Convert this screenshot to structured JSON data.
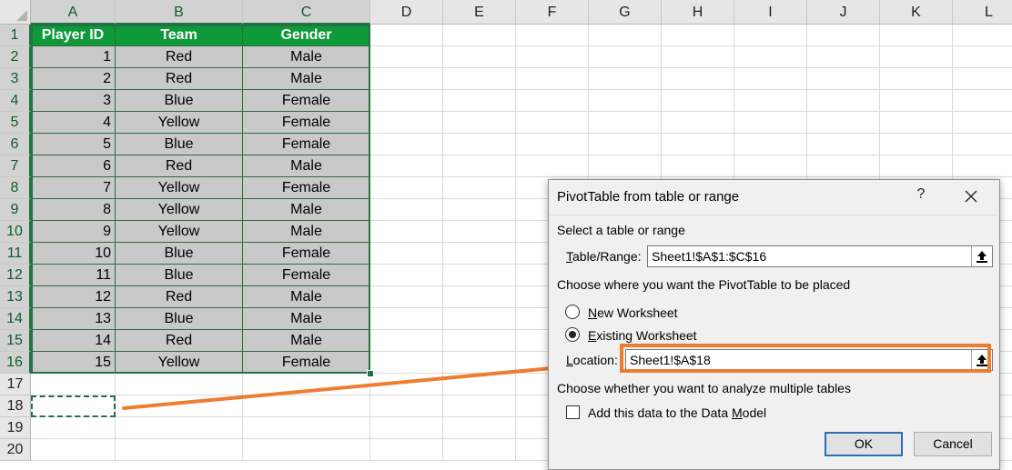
{
  "spreadsheet": {
    "columns": [
      "A",
      "B",
      "C",
      "D",
      "E",
      "F",
      "G",
      "H",
      "I",
      "J",
      "K",
      "L"
    ],
    "rows": [
      "1",
      "2",
      "3",
      "4",
      "5",
      "6",
      "7",
      "8",
      "9",
      "10",
      "11",
      "12",
      "13",
      "14",
      "15",
      "16",
      "17",
      "18",
      "19",
      "20"
    ],
    "headers": [
      "Player ID",
      "Team",
      "Gender"
    ],
    "data": [
      [
        "1",
        "Red",
        "Male"
      ],
      [
        "2",
        "Red",
        "Male"
      ],
      [
        "3",
        "Blue",
        "Female"
      ],
      [
        "4",
        "Yellow",
        "Female"
      ],
      [
        "5",
        "Blue",
        "Female"
      ],
      [
        "6",
        "Red",
        "Male"
      ],
      [
        "7",
        "Yellow",
        "Female"
      ],
      [
        "8",
        "Yellow",
        "Male"
      ],
      [
        "9",
        "Yellow",
        "Male"
      ],
      [
        "10",
        "Blue",
        "Female"
      ],
      [
        "11",
        "Blue",
        "Female"
      ],
      [
        "12",
        "Red",
        "Male"
      ],
      [
        "13",
        "Blue",
        "Male"
      ],
      [
        "14",
        "Red",
        "Male"
      ],
      [
        "15",
        "Yellow",
        "Female"
      ]
    ]
  },
  "dialog": {
    "title": "PivotTable from table or range",
    "help_label": "?",
    "close_icon": "close-icon",
    "select_section": "Select a table or range",
    "table_range_label": "Table/Range:",
    "table_range_value": "Sheet1!$A$1:$C$16",
    "placement_section": "Choose where you want the PivotTable to be placed",
    "new_worksheet_label": "New Worksheet",
    "existing_worksheet_label": "Existing Worksheet",
    "selected_option": "existing",
    "location_label": "Location:",
    "location_value": "Sheet1!$A$18",
    "multiple_tables_section": "Choose whether you want to analyze multiple tables",
    "data_model_label": "Add this data to the Data Model",
    "data_model_checked": false,
    "ok_label": "OK",
    "cancel_label": "Cancel",
    "collapse_icon": "collapse-dialog-icon"
  },
  "colors": {
    "header_fill": "#0f9a3a",
    "data_fill": "#c9c9c9",
    "border": "#2e6b3e",
    "selection": "#217346",
    "annotation": "#ed7d31"
  }
}
